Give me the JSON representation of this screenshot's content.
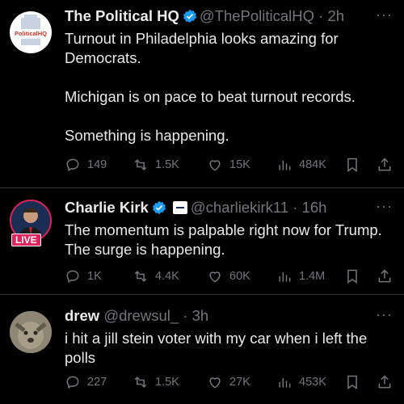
{
  "tweets": [
    {
      "name": "The Political HQ",
      "handle": "@ThePoliticalHQ",
      "time": "· 2h",
      "text": "Turnout in Philadelphia looks amazing for Democrats.\n\nMichigan is on pace to beat turnout records.\n\nSomething is happening.",
      "avatar_logo": "PoliticalHQ",
      "verified_color": "#1d9bf0",
      "stats": {
        "replies": "149",
        "reposts": "1.5K",
        "likes": "15K",
        "views": "484K"
      }
    },
    {
      "name": "Charlie Kirk",
      "handle": "@charliekirk11",
      "time": "· 16h",
      "text": "The momentum is palpable right now for Trump. The surge is happening.",
      "live_badge": "LIVE",
      "verified_color": "#1d9bf0",
      "stats": {
        "replies": "1K",
        "reposts": "4.4K",
        "likes": "60K",
        "views": "1.4M"
      }
    },
    {
      "name": "drew",
      "handle": "@drewsul_",
      "time": "· 3h",
      "text": "i hit a jill stein voter with my car when i left the polls",
      "stats": {
        "replies": "227",
        "reposts": "1.5K",
        "likes": "27K",
        "views": "453K"
      }
    }
  ],
  "more_glyph": "···",
  "colors": {
    "background": "#000000",
    "text": "#e7e9ea",
    "secondary": "#71767b",
    "divider": "#2f3336",
    "verified": "#1d9bf0",
    "live": "#e0245e"
  }
}
